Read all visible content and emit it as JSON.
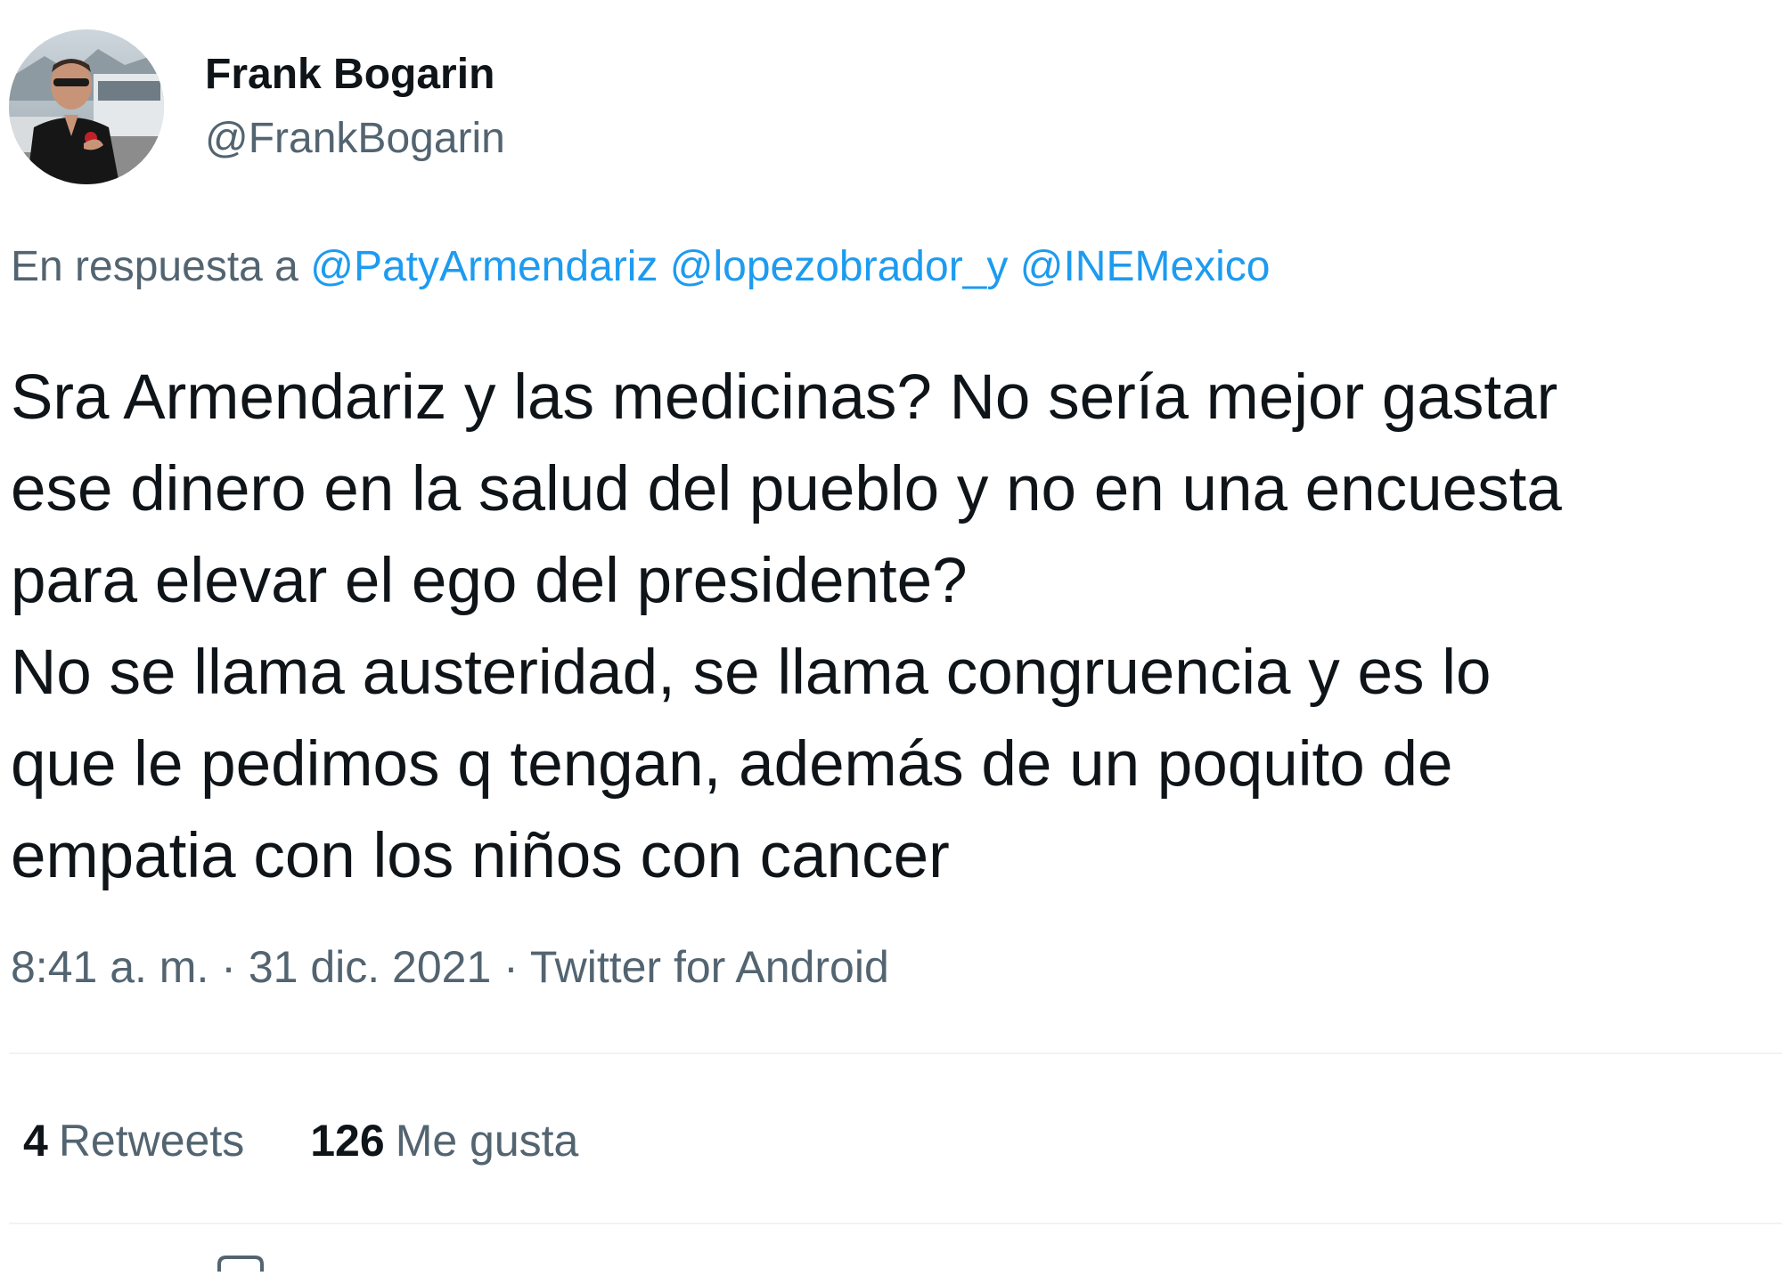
{
  "author": {
    "display_name": "Frank Bogarin",
    "handle": "@FrankBogarin",
    "avatar_icon": "user-avatar-photo"
  },
  "reply_context": {
    "prefix": "En respuesta a",
    "mentions": [
      "@PatyArmendariz",
      "@lopezobrador_",
      "@INEMexico"
    ],
    "joiner": "y"
  },
  "tweet": {
    "lines": [
      "Sra Armendariz y las medicinas? No sería mejor gastar",
      "ese dinero en la salud del pueblo y no en una encuesta",
      "para elevar el ego del presidente?",
      "No se llama austeridad, se llama congruencia y es lo",
      "que le pedimos q tengan, además de un poquito de",
      "empatia con los niños con cancer"
    ]
  },
  "meta": {
    "time": "8:41 a. m.",
    "separator": "·",
    "date": "31 dic. 2021",
    "source": "Twitter for Android"
  },
  "stats": {
    "retweets_count": "4",
    "retweets_label": "Retweets",
    "likes_count": "126",
    "likes_label": "Me gusta"
  },
  "colors": {
    "text": "#0f1419",
    "secondary": "#536471",
    "link": "#1d9bf0",
    "divider": "#eff3f4"
  }
}
